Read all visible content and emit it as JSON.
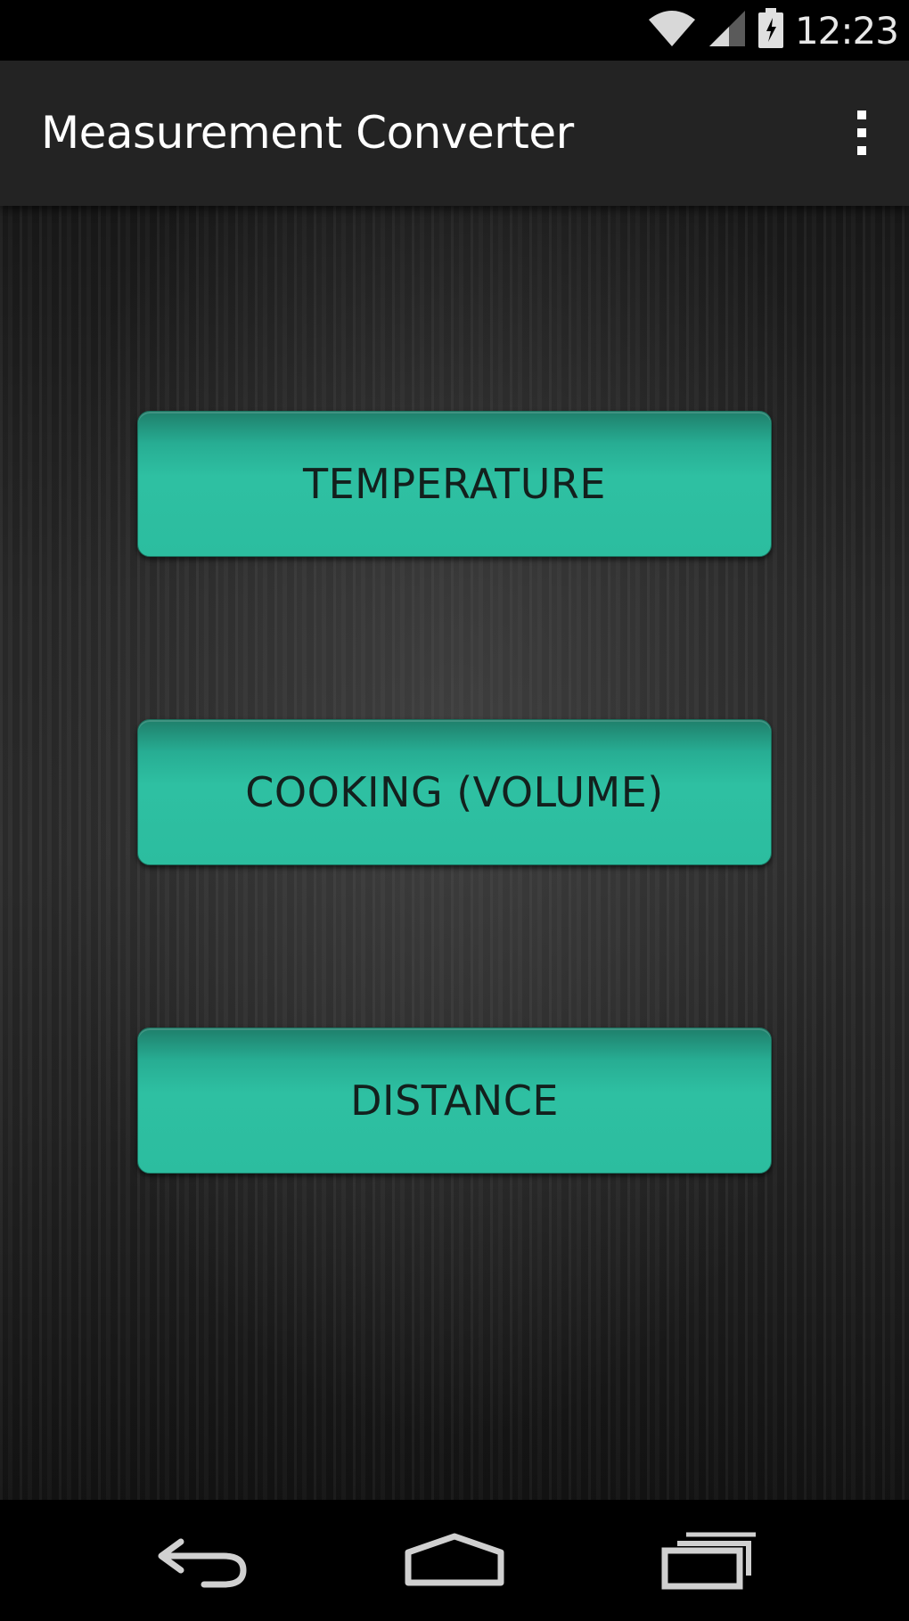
{
  "status_bar": {
    "time": "12:23",
    "icons": [
      "wifi-icon",
      "cell-signal-icon",
      "battery-icon"
    ]
  },
  "action_bar": {
    "title": "Measurement Converter",
    "overflow_icon": "overflow-menu-icon"
  },
  "buttons": [
    {
      "label": "TEMPERATURE"
    },
    {
      "label": "COOKING (VOLUME)"
    },
    {
      "label": "DISTANCE"
    }
  ],
  "nav_bar": {
    "icons": [
      "back-icon",
      "home-icon",
      "recent-apps-icon"
    ]
  },
  "colors": {
    "button_teal": "#2cbd9f",
    "action_bar_bg": "#232323",
    "status_bar_bg": "#000000"
  }
}
